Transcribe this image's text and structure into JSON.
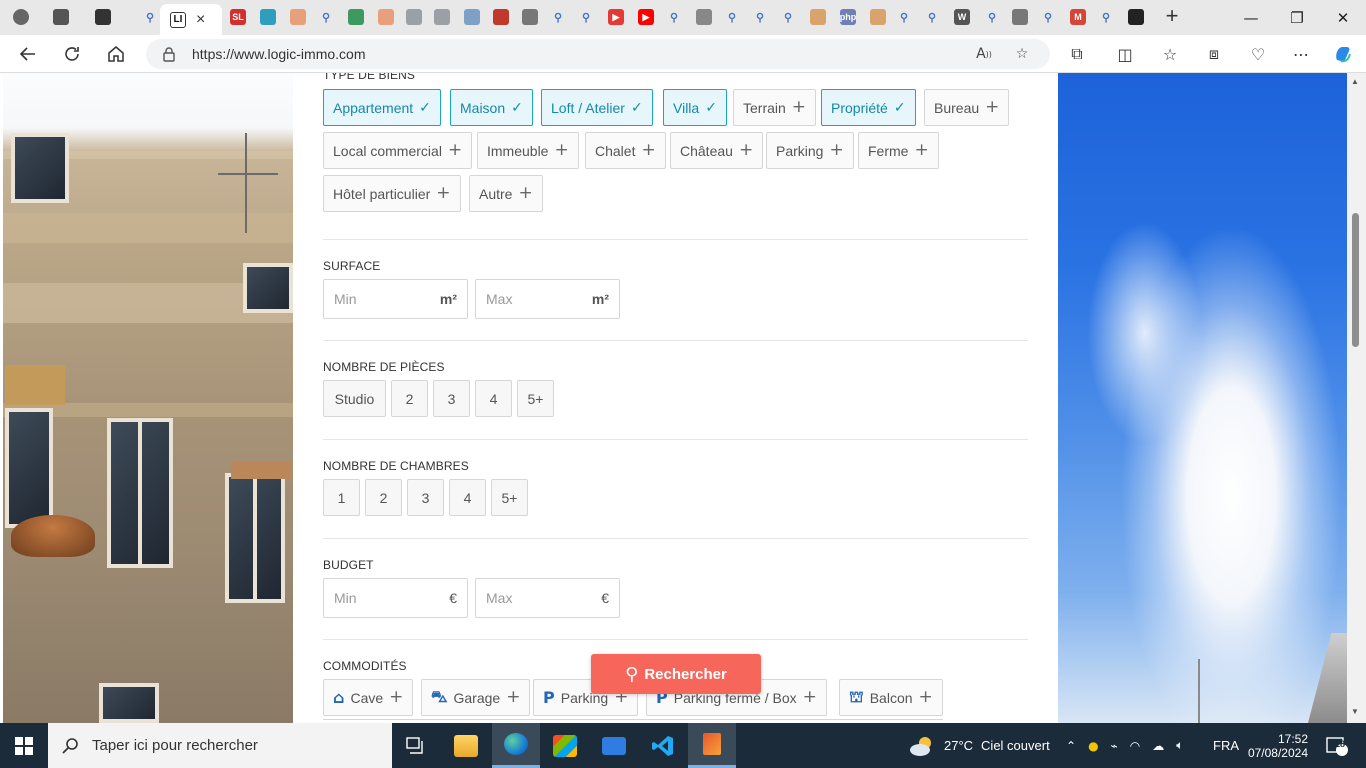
{
  "browser": {
    "active_tab_favicon": "LI",
    "close_tab_label": "×",
    "new_tab_label": "+",
    "url": "https://www.logic-immo.com",
    "window_controls": {
      "minimize": "—",
      "restore": "❐",
      "close": "✕"
    },
    "tab_favicons": [
      {
        "text": "",
        "color": "#666666",
        "kind": "profile"
      },
      {
        "text": "",
        "color": "#555555",
        "kind": "workspaces"
      },
      {
        "text": "",
        "color": "#333333",
        "kind": "tab-actions"
      },
      {
        "text": "⚲",
        "color": "#4a78c2",
        "kind": "search"
      },
      {
        "text": "SL",
        "color": "#d32f2f",
        "kind": "site"
      },
      {
        "text": "",
        "color": "#2e9dbe",
        "kind": "edge"
      },
      {
        "text": "",
        "color": "#e8a07a",
        "kind": "site"
      },
      {
        "text": "⚲",
        "color": "#4a78c2",
        "kind": "search"
      },
      {
        "text": "",
        "color": "#3c9a5f",
        "kind": "site"
      },
      {
        "text": "",
        "color": "#e8a07a",
        "kind": "site"
      },
      {
        "text": "",
        "color": "#9aa0a6",
        "kind": "site"
      },
      {
        "text": "",
        "color": "#9aa0a6",
        "kind": "site"
      },
      {
        "text": "",
        "color": "#7fa0c6",
        "kind": "site"
      },
      {
        "text": "",
        "color": "#c0392b",
        "kind": "pdf"
      },
      {
        "text": "",
        "color": "#777777",
        "kind": "site"
      },
      {
        "text": "⚲",
        "color": "#4a78c2",
        "kind": "search"
      },
      {
        "text": "⚲",
        "color": "#4a78c2",
        "kind": "search"
      },
      {
        "text": "▶",
        "color": "#e53935",
        "kind": "youtube"
      },
      {
        "text": "▶",
        "color": "#ff0000",
        "kind": "youtube"
      },
      {
        "text": "⚲",
        "color": "#4a78c2",
        "kind": "search"
      },
      {
        "text": "",
        "color": "#888888",
        "kind": "page"
      },
      {
        "text": "⚲",
        "color": "#4a78c2",
        "kind": "search"
      },
      {
        "text": "⚲",
        "color": "#4a78c2",
        "kind": "search"
      },
      {
        "text": "⚲",
        "color": "#4a78c2",
        "kind": "search"
      },
      {
        "text": "",
        "color": "#d9a36b",
        "kind": "site"
      },
      {
        "text": "php",
        "color": "#6f7fb3",
        "kind": "site"
      },
      {
        "text": "",
        "color": "#d9a36b",
        "kind": "site"
      },
      {
        "text": "⚲",
        "color": "#4a78c2",
        "kind": "search"
      },
      {
        "text": "⚲",
        "color": "#4a78c2",
        "kind": "search"
      },
      {
        "text": "W",
        "color": "#555555",
        "kind": "wikipedia"
      },
      {
        "text": "⚲",
        "color": "#4a78c2",
        "kind": "search"
      },
      {
        "text": "",
        "color": "#777777",
        "kind": "site"
      },
      {
        "text": "⚲",
        "color": "#4a78c2",
        "kind": "search"
      },
      {
        "text": "M",
        "color": "#d44638",
        "kind": "gmail"
      },
      {
        "text": "⚲",
        "color": "#4a78c2",
        "kind": "search"
      },
      {
        "text": "",
        "color": "#222222",
        "kind": "github"
      }
    ]
  },
  "form": {
    "type_title": "TYPE DE BIENS",
    "property_types": [
      {
        "label": "Appartement",
        "selected": true
      },
      {
        "label": "Maison",
        "selected": true
      },
      {
        "label": "Loft / Atelier",
        "selected": true
      },
      {
        "label": "Villa",
        "selected": true
      },
      {
        "label": "Terrain",
        "selected": false
      },
      {
        "label": "Propriété",
        "selected": true
      },
      {
        "label": "Bureau",
        "selected": false
      },
      {
        "label": "Local commercial",
        "selected": false
      },
      {
        "label": "Immeuble",
        "selected": false
      },
      {
        "label": "Chalet",
        "selected": false
      },
      {
        "label": "Château",
        "selected": false
      },
      {
        "label": "Parking",
        "selected": false
      },
      {
        "label": "Ferme",
        "selected": false
      },
      {
        "label": "Hôtel particulier",
        "selected": false
      },
      {
        "label": "Autre",
        "selected": false
      }
    ],
    "surface": {
      "title": "SURFACE",
      "min_placeholder": "Min",
      "max_placeholder": "Max",
      "unit": "m²"
    },
    "rooms": {
      "title": "NOMBRE DE PIÈCES",
      "options": [
        "Studio",
        "2",
        "3",
        "4",
        "5+"
      ]
    },
    "bedrooms": {
      "title": "NOMBRE DE CHAMBRES",
      "options": [
        "1",
        "2",
        "3",
        "4",
        "5+"
      ]
    },
    "budget": {
      "title": "BUDGET",
      "min_placeholder": "Min",
      "max_placeholder": "Max",
      "unit": "€"
    },
    "amenities": {
      "title": "COMMODITÉS",
      "items": [
        {
          "label": "Cave",
          "icon": "cellar-icon"
        },
        {
          "label": "Garage",
          "icon": "car-icon"
        },
        {
          "label": "Parking",
          "icon": "parking-icon"
        },
        {
          "label": "Parking fermé / Box",
          "icon": "parking-icon"
        },
        {
          "label": "Balcon",
          "icon": "balcony-icon"
        }
      ]
    },
    "search_button": "Rechercher"
  },
  "taskbar": {
    "search_placeholder": "Taper ici pour rechercher",
    "weather_temp": "27°C",
    "weather_text": "Ciel couvert",
    "language": "FRA",
    "time": "17:52",
    "date": "07/08/2024",
    "notifications": "18"
  },
  "colors": {
    "selected_chip_bg": "#e7f6fa",
    "selected_chip_border": "#19a6c3",
    "search_button": "#f7665b",
    "taskbar": "#1b2b3a"
  }
}
